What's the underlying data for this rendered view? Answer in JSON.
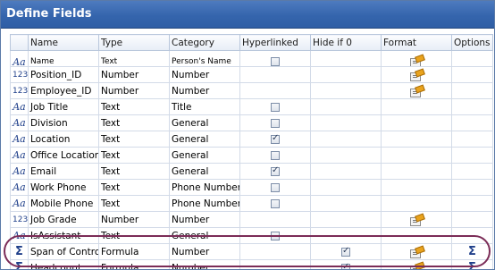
{
  "window": {
    "title": "Define Fields"
  },
  "columns": [
    "",
    "Name",
    "Type",
    "Category",
    "Hyperlinked",
    "Hide if 0",
    "Format",
    "Options"
  ],
  "clipped_row": {
    "icon": "Aa",
    "name": "Name",
    "type": "Text",
    "category": "Person's Name"
  },
  "rows": [
    {
      "icon": "123",
      "icon_name": "numeric-icon",
      "name": "Position_ID",
      "type": "Number",
      "category": "Number",
      "hyperlinked": null,
      "hide_if_zero": null,
      "format": true,
      "options": false
    },
    {
      "icon": "123",
      "icon_name": "numeric-icon",
      "name": "Employee_ID",
      "type": "Number",
      "category": "Number",
      "hyperlinked": null,
      "hide_if_zero": null,
      "format": true,
      "options": false
    },
    {
      "icon": "Aa",
      "icon_name": "text-icon",
      "name": "Job Title",
      "type": "Text",
      "category": "Title",
      "hyperlinked": false,
      "hide_if_zero": null,
      "format": false,
      "options": false
    },
    {
      "icon": "Aa",
      "icon_name": "text-icon",
      "name": "Division",
      "type": "Text",
      "category": "General",
      "hyperlinked": false,
      "hide_if_zero": null,
      "format": false,
      "options": false
    },
    {
      "icon": "Aa",
      "icon_name": "text-icon",
      "name": "Location",
      "type": "Text",
      "category": "General",
      "hyperlinked": true,
      "hide_if_zero": null,
      "format": false,
      "options": false
    },
    {
      "icon": "Aa",
      "icon_name": "text-icon",
      "name": "Office Location",
      "type": "Text",
      "category": "General",
      "hyperlinked": false,
      "hide_if_zero": null,
      "format": false,
      "options": false
    },
    {
      "icon": "Aa",
      "icon_name": "text-icon",
      "name": "Email",
      "type": "Text",
      "category": "General",
      "hyperlinked": true,
      "hide_if_zero": null,
      "format": false,
      "options": false
    },
    {
      "icon": "Aa",
      "icon_name": "text-icon",
      "name": "Work Phone",
      "type": "Text",
      "category": "Phone Number",
      "hyperlinked": false,
      "hide_if_zero": null,
      "format": false,
      "options": false
    },
    {
      "icon": "Aa",
      "icon_name": "text-icon",
      "name": "Mobile Phone",
      "type": "Text",
      "category": "Phone Number",
      "hyperlinked": false,
      "hide_if_zero": null,
      "format": false,
      "options": false
    },
    {
      "icon": "123",
      "icon_name": "numeric-icon",
      "name": "Job Grade",
      "type": "Number",
      "category": "Number",
      "hyperlinked": null,
      "hide_if_zero": null,
      "format": true,
      "options": false
    },
    {
      "icon": "Aa",
      "icon_name": "text-icon",
      "name": "IsAssistant",
      "type": "Text",
      "category": "General",
      "hyperlinked": false,
      "hide_if_zero": null,
      "format": false,
      "options": false
    },
    {
      "icon": "Σ",
      "icon_name": "sigma-icon",
      "name": "Span of Control",
      "type": "Formula",
      "category": "Number",
      "hyperlinked": null,
      "hide_if_zero": true,
      "hide_selected": true,
      "format": true,
      "options": true
    },
    {
      "icon": "Σ",
      "icon_name": "sigma-icon",
      "name": "Headcount",
      "type": "Formula",
      "category": "Number",
      "hyperlinked": null,
      "hide_if_zero": true,
      "format": true,
      "options": true
    }
  ],
  "options_glyph": "Σ",
  "accent_colors": {
    "titlebar": "#3565ad",
    "selection": "#3f74c7",
    "highlight_oval": "#7b2c57"
  }
}
